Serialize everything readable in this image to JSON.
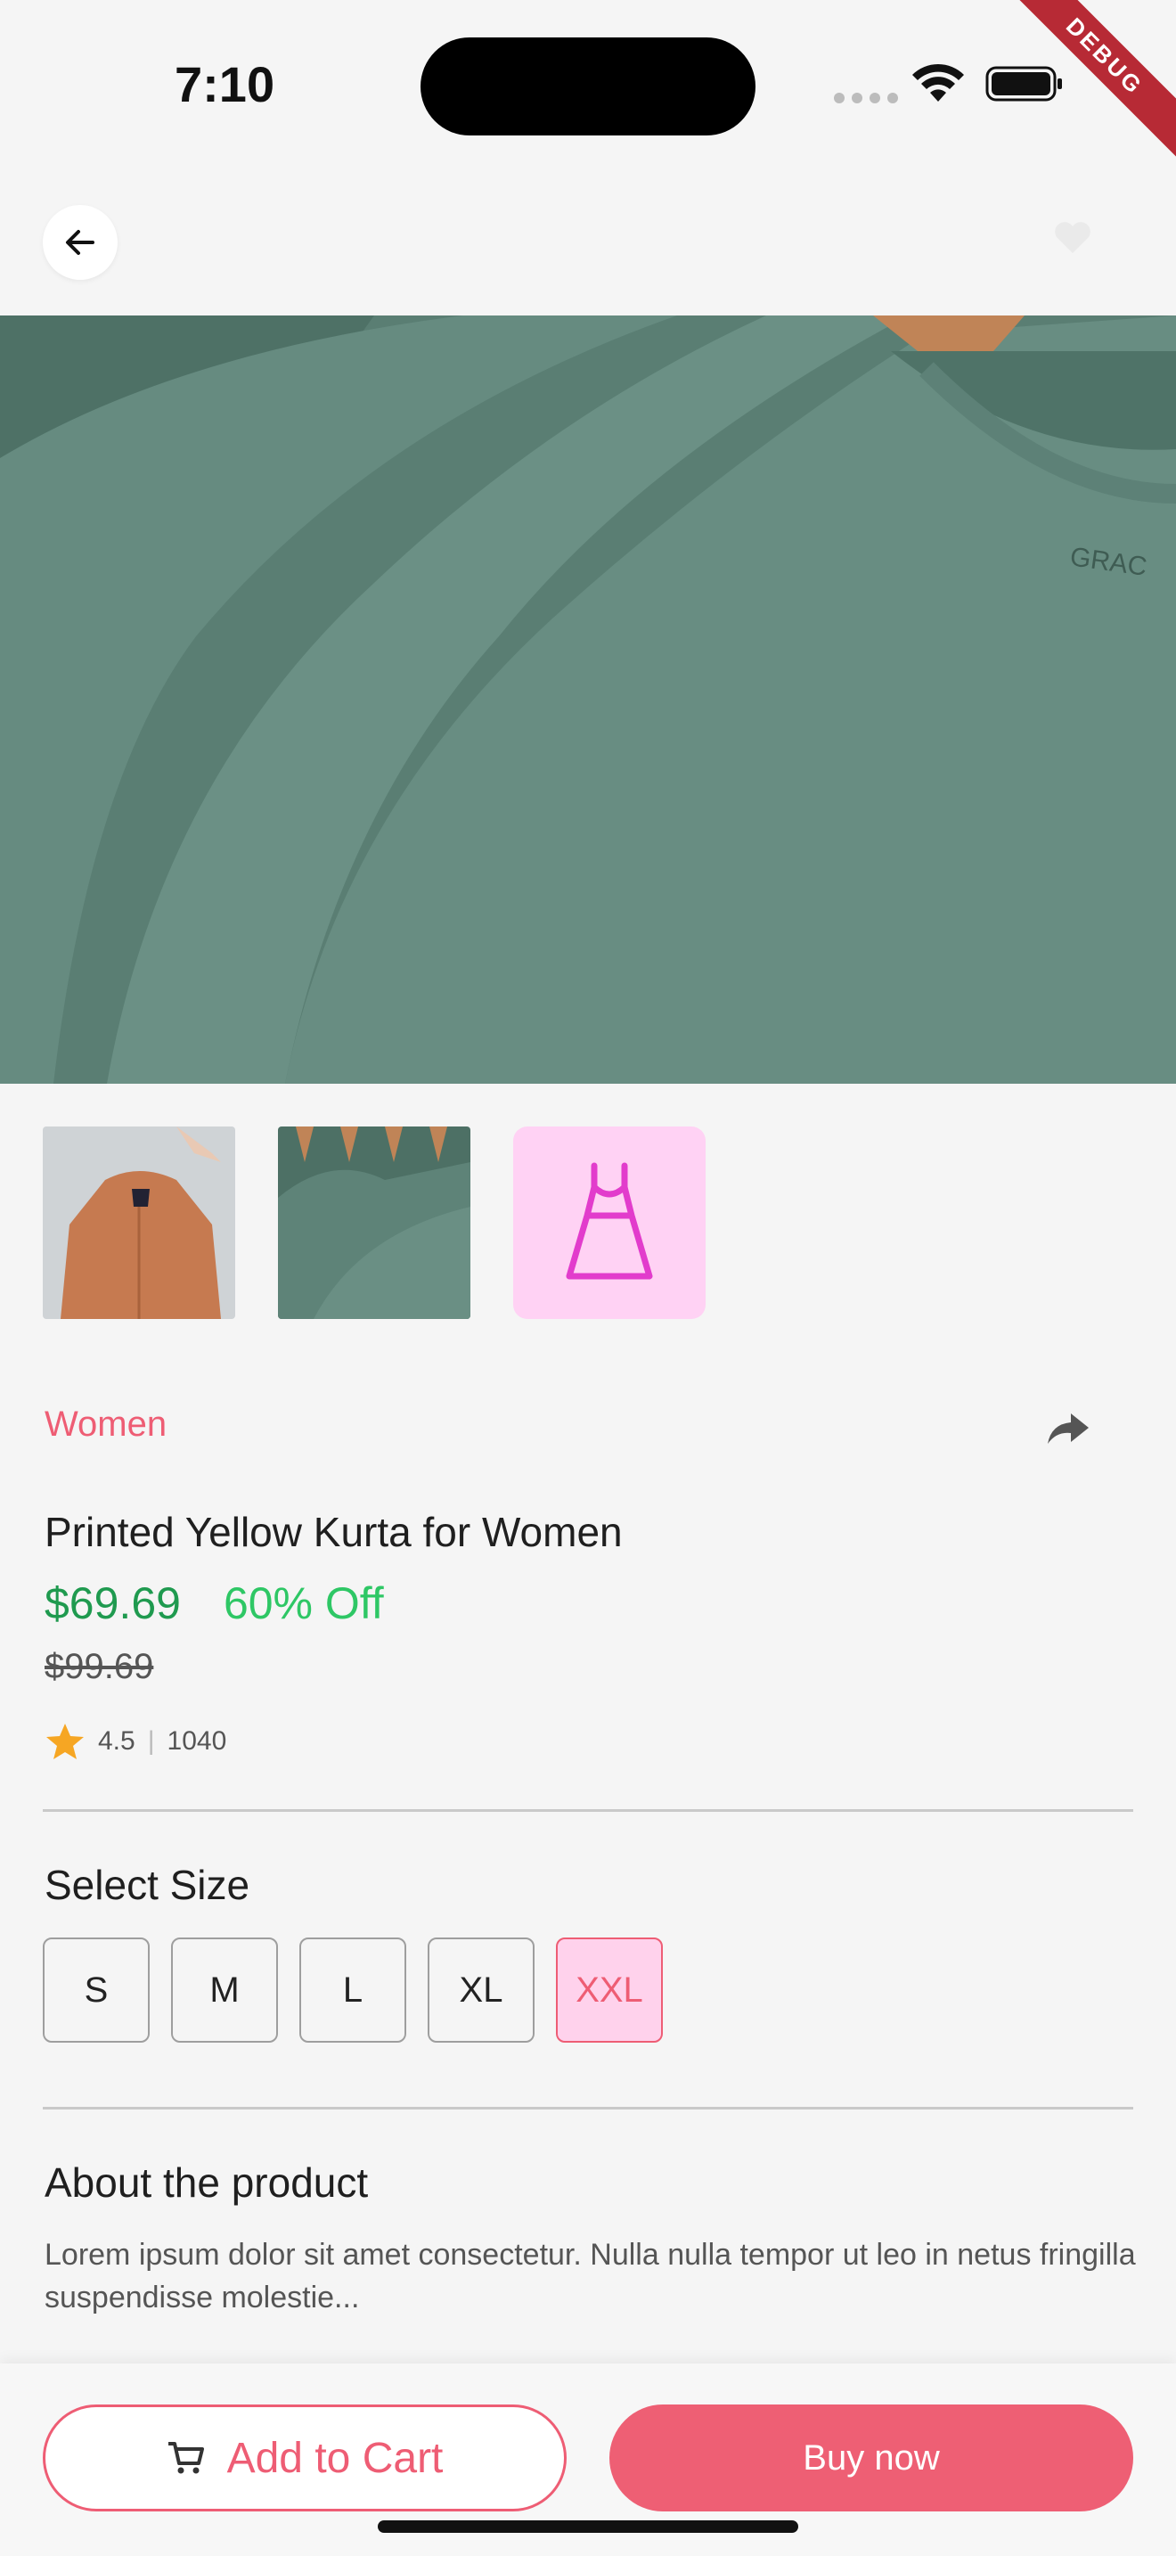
{
  "status_bar": {
    "time": "7:10",
    "debug_label": "DEBUG",
    "icons": [
      "cellular-icon",
      "wifi-icon",
      "battery-icon"
    ]
  },
  "app_bar": {
    "back_icon": "arrow-left-icon",
    "wishlist_icon": "heart-icon"
  },
  "gallery": {
    "thumbnails": [
      "orange-jacket-image",
      "green-tshirts-image",
      "dress-icon"
    ],
    "accent_color": "#ee5d74",
    "thumb_bg_color": "#ffd2f4"
  },
  "product": {
    "category": "Women",
    "share_icon": "share-icon",
    "title": "Printed Yellow Kurta for Women",
    "price": "$69.69",
    "discount": "60% Off",
    "original_price": "$99.69",
    "rating": "4.5",
    "rating_separator": "|",
    "reviews_count": "1040",
    "price_color": "#1f9a4f",
    "discount_color": "#2ec765"
  },
  "size_section": {
    "title": "Select Size",
    "sizes": [
      "S",
      "M",
      "L",
      "XL",
      "XXL"
    ],
    "selected": "XXL"
  },
  "about_section": {
    "title": "About the product",
    "text": "Lorem ipsum dolor sit amet consectetur. Nulla nulla tempor ut leo in netus fringilla suspendisse molestie..."
  },
  "actions": {
    "add_to_cart_label": "Add to Cart",
    "buy_now_label": "Buy now",
    "cart_icon": "cart-icon",
    "primary_color": "#ee5f74"
  }
}
